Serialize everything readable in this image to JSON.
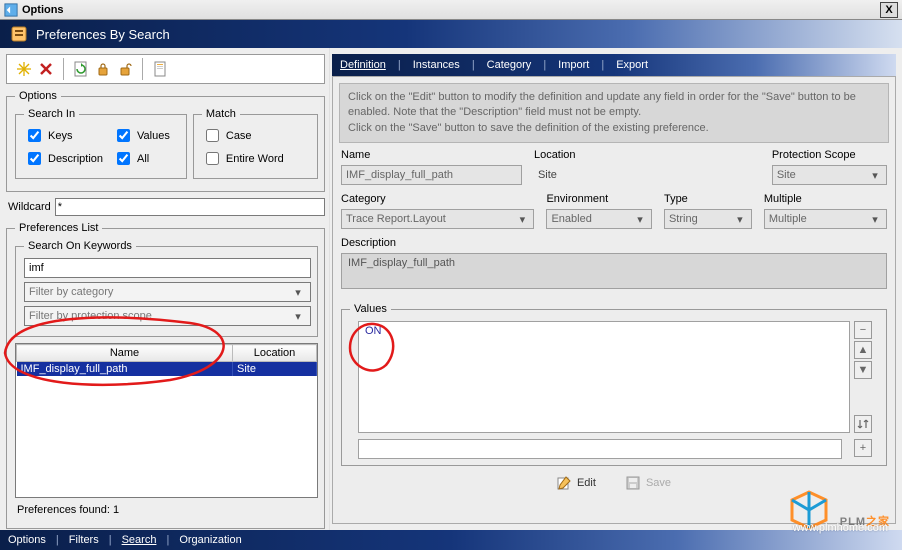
{
  "window": {
    "title": "Options",
    "close": "X"
  },
  "header": {
    "title": "Preferences By Search"
  },
  "left": {
    "options_legend": "Options",
    "search_in_legend": "Search In",
    "match_legend": "Match",
    "checks": {
      "keys": "Keys",
      "values": "Values",
      "description": "Description",
      "all": "All",
      "case": "Case",
      "entire": "Entire Word"
    },
    "wildcard_label": "Wildcard",
    "wildcard_value": "*",
    "prefs_list_legend": "Preferences List",
    "search_kw_legend": "Search On Keywords",
    "kw_value": "imf",
    "filter_cat_placeholder": "Filter by category",
    "filter_scope_placeholder": "Filter by protection scope",
    "table": {
      "cols": {
        "name": "Name",
        "location": "Location"
      },
      "rows": [
        {
          "name": "IMF_display_full_path",
          "location": "Site"
        }
      ]
    },
    "found_label": "Preferences found: 1"
  },
  "right": {
    "tabs": [
      "Definition",
      "Instances",
      "Category",
      "Import",
      "Export"
    ],
    "active_tab": 0,
    "info_line1": "Click on the \"Edit\" button to modify the definition and update any field in order for the \"Save\" button to be enabled. Note that the \"Description\" field must not be empty.",
    "info_line2": "Click on the \"Save\" button to save the definition of the existing preference.",
    "labels": {
      "name": "Name",
      "location": "Location",
      "pscope": "Protection Scope",
      "category": "Category",
      "env": "Environment",
      "type": "Type",
      "multiple": "Multiple",
      "description": "Description",
      "values": "Values"
    },
    "values": {
      "name": "IMF_display_full_path",
      "location": "Site",
      "pscope": "Site",
      "category": "Trace Report.Layout",
      "env": "Enabled",
      "type": "String",
      "multiple": "Multiple",
      "description": "IMF_display_full_path",
      "values_entry": "ON"
    },
    "actions": {
      "edit": "Edit",
      "save": "Save"
    }
  },
  "footer": {
    "items": [
      "Options",
      "Filters",
      "Search",
      "Organization"
    ],
    "active": 2
  },
  "logo": {
    "text1": "PLM",
    "text2": "之家",
    "sub": "www.plmhome.com"
  }
}
